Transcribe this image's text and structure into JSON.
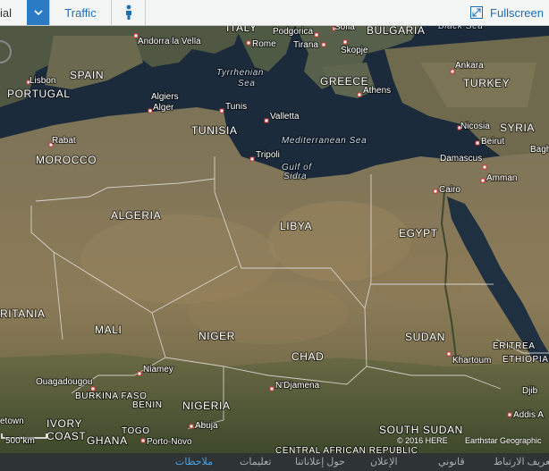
{
  "toolbar": {
    "view_label": "ial",
    "traffic_label": "Traffic",
    "fullscreen_label": "Fullscreen"
  },
  "map": {
    "countries": [
      "SPAIN",
      "PORTUGAL",
      "ITALY",
      "BULGARIA",
      "TURKEY",
      "GREECE",
      "SYRIA",
      "MOROCCO",
      "TUNISIA",
      "ALGERIA",
      "LIBYA",
      "EGYPT",
      "RITANIA",
      "MALI",
      "NIGER",
      "CHAD",
      "SUDAN",
      "ERITREA",
      "ETHIOPIA",
      "NIGERIA",
      "IVORY",
      "COAST",
      "GHANA",
      "SOUTH SUDAN",
      "BURKINA FASO",
      "BENIN",
      "TOGO",
      "CENTRAL AFRICAN REPUBLIC"
    ],
    "cities": [
      "Andorra la Vella",
      "Rome",
      "Podgorica",
      "Tirana",
      "Sofia",
      "Skopje",
      "Ankara",
      "Lisbon",
      "Algiers",
      "Alger",
      "Tunis",
      "Valletta",
      "Athens",
      "Nicosia",
      "Beirut",
      "Damascus",
      "Amman",
      "Bagh",
      "Rabat",
      "Tripoli",
      "Cairo",
      "Niamey",
      "Ouagadougou",
      "N'Djamena",
      "Khartoum",
      "Abuja",
      "Porto-Novo",
      "Addis A",
      "Djib",
      "etown"
    ],
    "seas": [
      "Tyrrhenian",
      "Sea",
      "Mediterranean Sea",
      "Gulf of",
      "Sidra",
      "Black Sea"
    ],
    "scale": "500 km",
    "copyright": "© 2016 HERE",
    "copyright2": "Earthstar Geographic"
  },
  "footer": {
    "links": [
      "تعريف الارتباط",
      "قانوني",
      "الإعلان",
      "حول إعلاناتنا",
      "تعليمات",
      "ملاحظات"
    ]
  },
  "colors": {
    "accent": "#2b7bc4",
    "land": "#8a7a58",
    "water": "#1c2d3e",
    "footer_bg": "#2e3436"
  }
}
